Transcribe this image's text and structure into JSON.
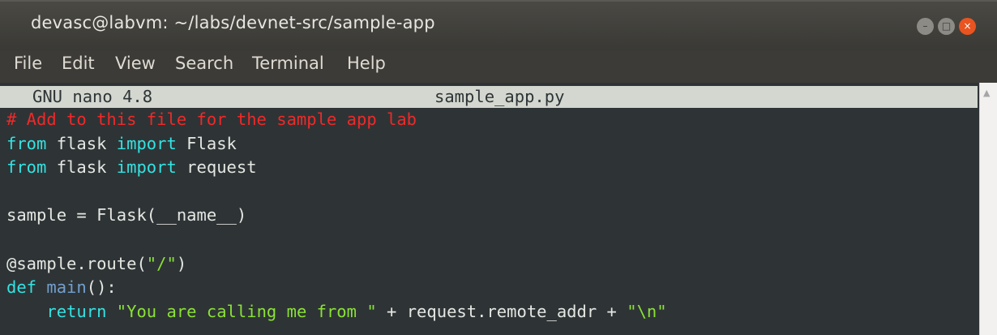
{
  "window": {
    "title": "devasc@labvm: ~/labs/devnet-src/sample-app",
    "controls": {
      "minimize": "–",
      "maximize": "□",
      "close": "×"
    }
  },
  "menu": [
    "File",
    "Edit",
    "View",
    "Search",
    "Terminal",
    "Help"
  ],
  "nano": {
    "version": "GNU nano 4.8",
    "filename": "sample_app.py"
  },
  "code_lines": [
    [
      {
        "t": "# Add to this file for the sample app lab",
        "c": "comment"
      }
    ],
    [
      {
        "t": "from",
        "c": "kw"
      },
      {
        "t": " flask ",
        "c": "plain"
      },
      {
        "t": "import",
        "c": "kw"
      },
      {
        "t": " Flask",
        "c": "plain"
      }
    ],
    [
      {
        "t": "from",
        "c": "kw"
      },
      {
        "t": " flask ",
        "c": "plain"
      },
      {
        "t": "import",
        "c": "kw"
      },
      {
        "t": " request",
        "c": "plain"
      }
    ],
    [],
    [
      {
        "t": "sample = Flask(__name__)",
        "c": "plain"
      }
    ],
    [],
    [
      {
        "t": "@sample.route(",
        "c": "plain"
      },
      {
        "t": "\"/\"",
        "c": "str"
      },
      {
        "t": ")",
        "c": "plain"
      }
    ],
    [
      {
        "t": "def",
        "c": "kw"
      },
      {
        "t": " ",
        "c": "plain"
      },
      {
        "t": "main",
        "c": "blue"
      },
      {
        "t": "():",
        "c": "plain"
      }
    ],
    [
      {
        "t": "    ",
        "c": "plain"
      },
      {
        "t": "return",
        "c": "kw"
      },
      {
        "t": " ",
        "c": "plain"
      },
      {
        "t": "\"You are calling me from \"",
        "c": "str"
      },
      {
        "t": " + request.remote_addr + ",
        "c": "plain"
      },
      {
        "t": "\"\\n\"",
        "c": "str"
      }
    ]
  ],
  "colors": {
    "titlebar": "#3d3c38",
    "terminal_bg": "#2e3436",
    "comment": "#ef2929",
    "keyword": "#34e2e2",
    "string": "#8ae234",
    "close_button": "#e95420"
  }
}
